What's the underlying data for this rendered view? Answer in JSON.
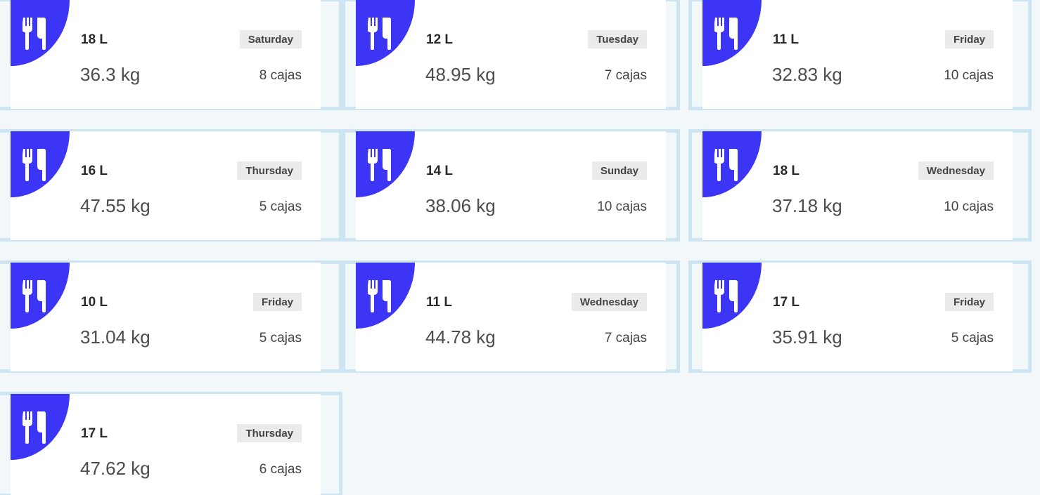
{
  "accent_color": "#3d35f5",
  "cards": [
    {
      "liters": "18 L",
      "day": "Saturday",
      "weight": "36.3 kg",
      "boxes": "8 cajas",
      "icon": "utensils-icon"
    },
    {
      "liters": "12 L",
      "day": "Tuesday",
      "weight": "48.95 kg",
      "boxes": "7 cajas",
      "icon": "utensils-icon"
    },
    {
      "liters": "11 L",
      "day": "Friday",
      "weight": "32.83 kg",
      "boxes": "10 cajas",
      "icon": "utensils-icon"
    },
    {
      "liters": "16 L",
      "day": "Thursday",
      "weight": "47.55 kg",
      "boxes": "5 cajas",
      "icon": "utensils-icon"
    },
    {
      "liters": "14 L",
      "day": "Sunday",
      "weight": "38.06 kg",
      "boxes": "10 cajas",
      "icon": "utensils-icon"
    },
    {
      "liters": "18 L",
      "day": "Wednesday",
      "weight": "37.18 kg",
      "boxes": "10 cajas",
      "icon": "utensils-icon"
    },
    {
      "liters": "10 L",
      "day": "Friday",
      "weight": "31.04 kg",
      "boxes": "5 cajas",
      "icon": "utensils-icon"
    },
    {
      "liters": "11 L",
      "day": "Wednesday",
      "weight": "44.78 kg",
      "boxes": "7 cajas",
      "icon": "utensils-icon"
    },
    {
      "liters": "17 L",
      "day": "Friday",
      "weight": "35.91 kg",
      "boxes": "5 cajas",
      "icon": "utensils-icon"
    },
    {
      "liters": "17 L",
      "day": "Thursday",
      "weight": "47.62 kg",
      "boxes": "6 cajas",
      "icon": "utensils-icon"
    }
  ]
}
